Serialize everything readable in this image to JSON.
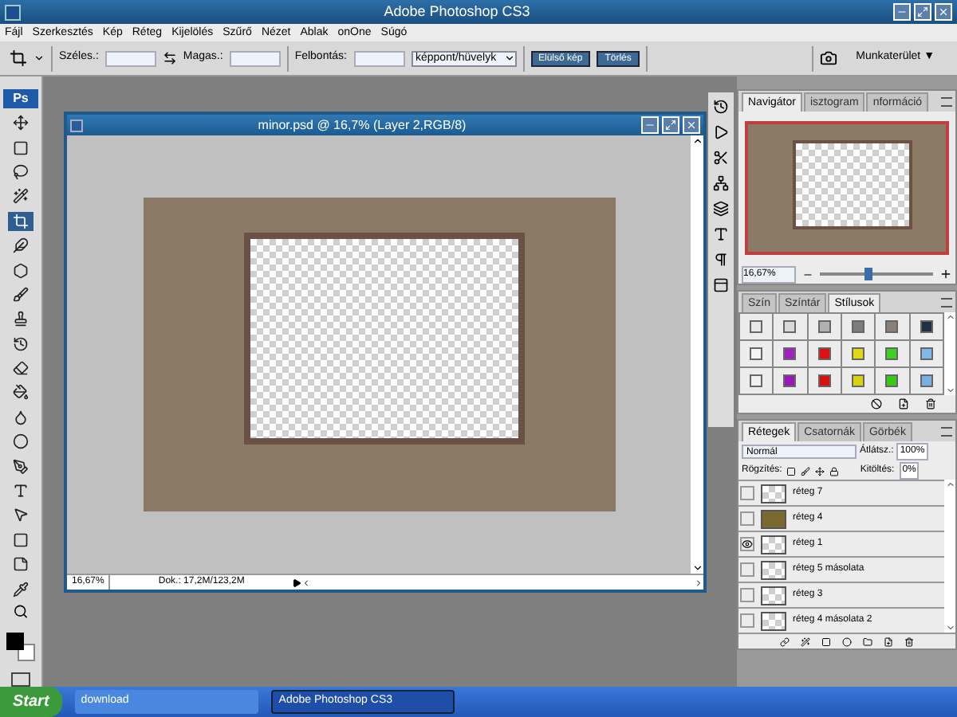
{
  "window": {
    "title": "Adobe Photoshop CS3"
  },
  "menu": [
    "Fájl",
    "Szerkesztés",
    "Kép",
    "Réteg",
    "Kijelölés",
    "Szűrő",
    "Nézet",
    "Ablak",
    "onOne",
    "Súgó"
  ],
  "options_bar": {
    "width_label": "Széles.:",
    "height_label": "Magas.:",
    "resolution_label": "Felbontás:",
    "unit": "képpont/hüvelyk",
    "buttons": [
      "Elülső kép",
      "Törlés"
    ],
    "workspace": "Munkaterület ▼"
  },
  "toolbox": {
    "logo": "Ps",
    "tools": [
      {
        "selected": false
      },
      {
        "selected": false
      },
      {
        "selected": false
      },
      {
        "selected": false
      },
      {
        "selected": true
      },
      {
        "selected": false
      },
      {
        "selected": false
      },
      {
        "selected": false
      },
      {
        "selected": false
      },
      {
        "selected": false
      },
      {
        "selected": false
      },
      {
        "selected": false
      },
      {
        "selected": false
      },
      {
        "selected": false
      },
      {
        "selected": false
      },
      {
        "selected": false
      },
      {
        "selected": false
      },
      {
        "selected": false
      },
      {
        "selected": false
      },
      {
        "selected": false
      }
    ]
  },
  "document": {
    "title": "minor.psd @ 16,7% (Layer 2,RGB/8)",
    "zoom": "16,67%",
    "doc_size": "Dok.: 17,2M/123,2M"
  },
  "navigator": {
    "tabs": [
      {
        "label": "Navigátor",
        "selected": true
      },
      {
        "label": "isztogram",
        "selected": false
      },
      {
        "label": "nformáció",
        "selected": false
      }
    ],
    "zoom": "16,67%",
    "level": 0.4
  },
  "styles": {
    "tabs": [
      {
        "label": "Szín",
        "selected": false
      },
      {
        "label": "Színtár",
        "selected": false
      },
      {
        "label": "Stílusok",
        "selected": true
      }
    ],
    "swatches": [
      {
        "color": "#e8e8e8"
      },
      {
        "color": "#d8d8d8"
      },
      {
        "color": "#b0b0b0"
      },
      {
        "color": "#7c7c7c"
      },
      {
        "color": "#8a8078"
      },
      {
        "color": "#203040"
      },
      {
        "color": "#f4f4f4"
      },
      {
        "color": "#a020c0"
      },
      {
        "color": "#e01010"
      },
      {
        "color": "#e0d810"
      },
      {
        "color": "#40d020"
      },
      {
        "color": "#80b8e8"
      },
      {
        "color": "#f0f0f0"
      },
      {
        "color": "#9818b8"
      },
      {
        "color": "#d81010"
      },
      {
        "color": "#d8d010"
      },
      {
        "color": "#38c818"
      },
      {
        "color": "#78b0e0"
      }
    ]
  },
  "layers": {
    "tabs": [
      {
        "label": "Rétegek",
        "selected": true
      },
      {
        "label": "Csatornák",
        "selected": false
      },
      {
        "label": "Görbék",
        "selected": false
      }
    ],
    "blend_mode": "Normál",
    "opacity_label": "Átlátsz.:",
    "opacity": "100%",
    "lock_label": "Rögzítés:",
    "fill_label": "Kitöltés:",
    "fill": "0%",
    "rows": [
      {
        "name": "réteg 7",
        "visible": false,
        "kind": "transparent"
      },
      {
        "name": "réteg 4",
        "visible": false,
        "kind": "image"
      },
      {
        "name": "réteg 1",
        "visible": true,
        "kind": "transparent"
      },
      {
        "name": "réteg 5 másolata",
        "visible": false,
        "kind": "transparent"
      },
      {
        "name": "réteg 3",
        "visible": false,
        "kind": "transparent"
      },
      {
        "name": "réteg 4 másolata 2",
        "visible": false,
        "kind": "transparent"
      }
    ]
  },
  "taskbar": {
    "start": "Start",
    "items": [
      {
        "label": "download",
        "selected": false
      },
      {
        "label": "Adobe Photoshop CS3",
        "selected": true
      }
    ]
  }
}
